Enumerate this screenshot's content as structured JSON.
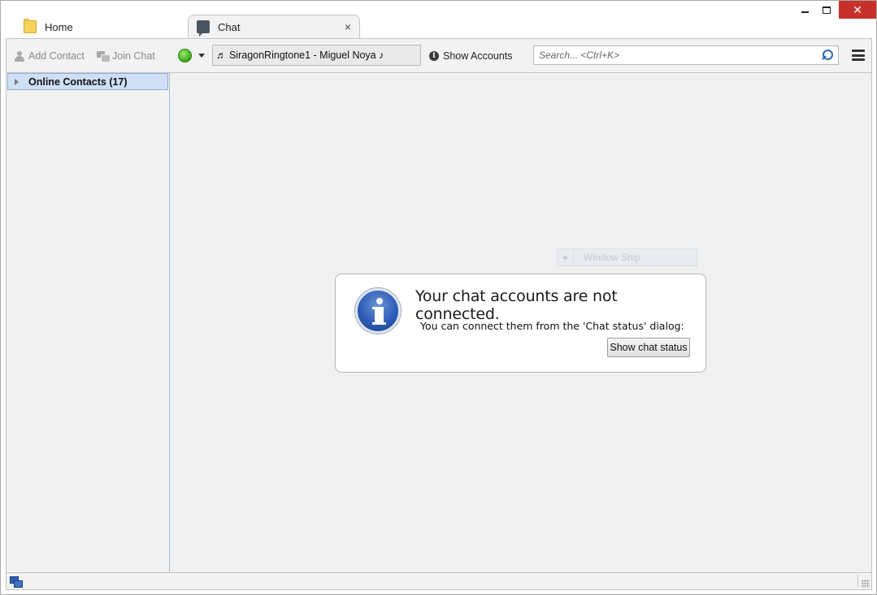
{
  "tabs": [
    {
      "label": "Home",
      "icon": "folder-icon",
      "active": false
    },
    {
      "label": "Chat",
      "icon": "chat-bubble-icon",
      "active": true,
      "close": "×"
    }
  ],
  "window_controls": {
    "minimize": "",
    "maximize": "",
    "close": "✕"
  },
  "toolbar": {
    "add_contact": "Add Contact",
    "join_chat": "Join Chat",
    "status_color": "#3ca51a",
    "status_message": "♬ SiragonRingtone1 - Miguel Noya ♪",
    "show_accounts": "Show Accounts",
    "search_placeholder": "Search... <Ctrl+K>"
  },
  "sidebar": {
    "group_label": "Online Contacts (17)"
  },
  "overlay": {
    "snip_label": "Window Snip"
  },
  "notice": {
    "title": "Your chat accounts are not connected.",
    "text": "You can connect them from the 'Chat status' dialog:",
    "button": "Show chat status"
  }
}
